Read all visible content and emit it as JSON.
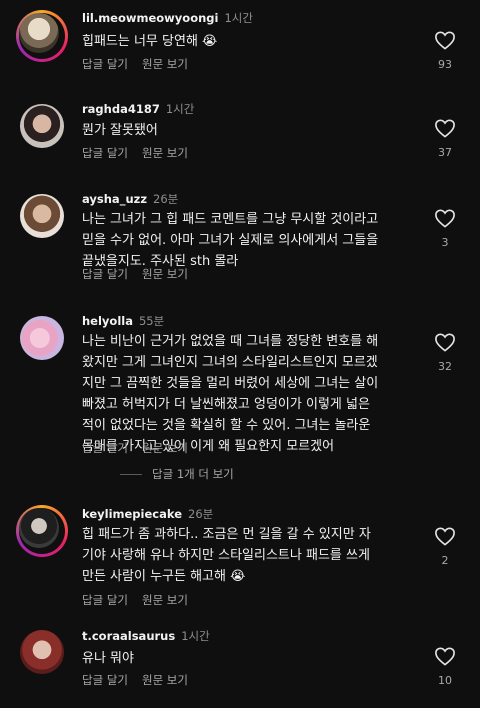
{
  "comments": [
    {
      "user": "lil.meowmeowyoongi",
      "time": "1시간",
      "text": "힙패드는 너무 당연해 😭",
      "reply": "답글 달기",
      "original": "원문 보기",
      "likes": "93"
    },
    {
      "user": "raghda4187",
      "time": "1시간",
      "text": "뭔가 잘못됐어",
      "reply": "답글 달기",
      "original": "원문 보기",
      "likes": "37"
    },
    {
      "user": "aysha_uzz",
      "time": "26분",
      "text": "나는 그녀가 그 힙 패드 코멘트를 그냥 무시할 것이라고 믿을 수가 없어. 아마 그녀가 실제로 의사에게서 그들을 끝냈을지도. 주사된 sth 몰라",
      "reply": "답글 달기",
      "original": "원문 보기",
      "likes": "3"
    },
    {
      "user": "helyolla",
      "time": "55분",
      "text": "나는 비난이 근거가 없었을 때 그녀를 정당한 변호를 해왔지만 그게 그녀인지 그녀의 스타일리스트인지 모르겠지만 그 끔찍한 것들을 멀리 버렸어 세상에 그녀는 살이 빠졌고 허벅지가 더 날씬해졌고 엉덩이가 이렇게 넓은 적이 없었다는 것을 확실히 할 수 있어. 그녀는 놀라운 몸매를 가지고 있어 이게 왜 필요한지 모르겠어",
      "reply": "답글 달기",
      "original": "원문 보기",
      "likes": "32",
      "more": "답글 1개 더 보기"
    },
    {
      "user": "keylimepiecake",
      "time": "26분",
      "text": "힙 패드가 좀 과하다.. 조금은 먼 길을 갈 수 있지만 자기야 사랑해 유나 하지만 스타일리스트나 패드를 쓰게 만든 사람이 누구든 해고해 😭",
      "reply": "답글 달기",
      "original": "원문 보기",
      "likes": "2"
    },
    {
      "user": "t.coraalsaurus",
      "time": "1시간",
      "text": "유나 뭐야",
      "reply": "답글 달기",
      "original": "원문 보기",
      "likes": "10"
    }
  ]
}
